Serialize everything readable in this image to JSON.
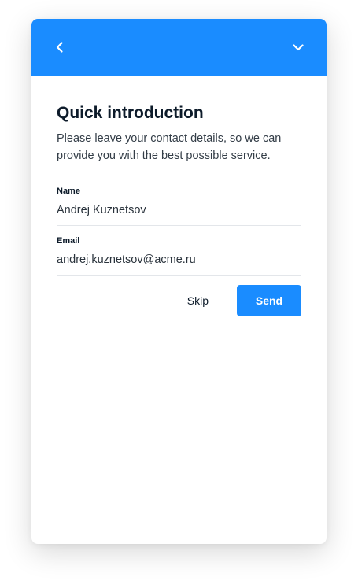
{
  "header": {
    "back_icon": "chevron-left-icon",
    "collapse_icon": "chevron-down-icon",
    "background_color": "#1a8cff"
  },
  "intro": {
    "title": "Quick introduction",
    "description": "Please leave your contact details, so we can provide you with the best possible service."
  },
  "form": {
    "name_label": "Name",
    "name_value": "Andrej Kuznetsov",
    "email_label": "Email",
    "email_value": "andrej.kuznetsov@acme.ru"
  },
  "actions": {
    "skip_label": "Skip",
    "send_label": "Send",
    "accent_color": "#1a8cff"
  }
}
